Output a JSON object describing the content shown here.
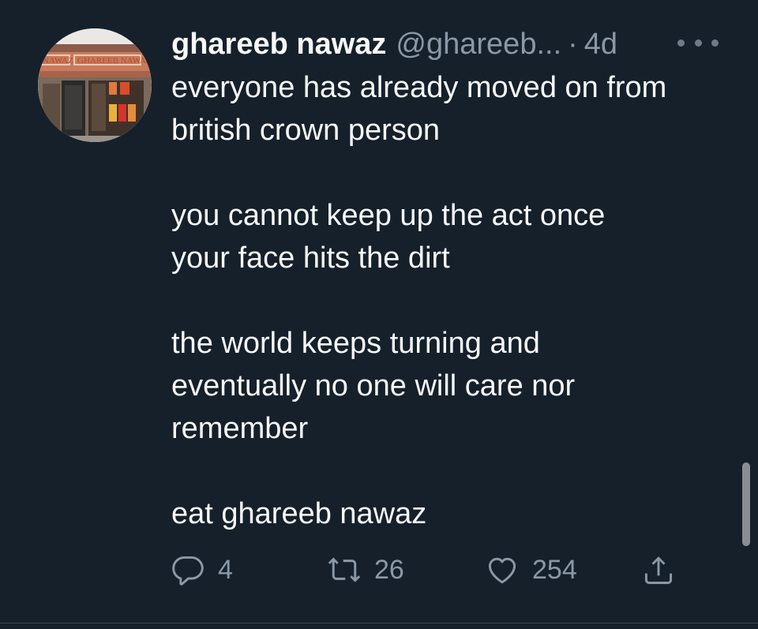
{
  "tweet": {
    "display_name": "ghareeb nawaz",
    "handle": "@ghareeb...",
    "separator": "·",
    "time": "4d",
    "avatar": {
      "sign_left": "NAWAZ",
      "sign_main": "GHAREEB NAWAZ"
    },
    "body": [
      "everyone has already moved on from",
      "british crown person",
      "",
      "you cannot keep up the act once",
      "your face hits the dirt",
      "",
      "the world keeps turning and",
      "eventually no one will care nor",
      "remember",
      "",
      "eat ghareeb nawaz"
    ],
    "actions": {
      "reply_count": "4",
      "retweet_count": "26",
      "like_count": "254"
    }
  },
  "icons": {
    "more": "more-horizontal-icon",
    "reply": "reply-icon",
    "retweet": "retweet-icon",
    "like": "heart-icon",
    "share": "share-icon"
  },
  "colors": {
    "background": "#15202b",
    "text_primary": "#f7f9f9",
    "text_secondary": "#8b98a5"
  }
}
